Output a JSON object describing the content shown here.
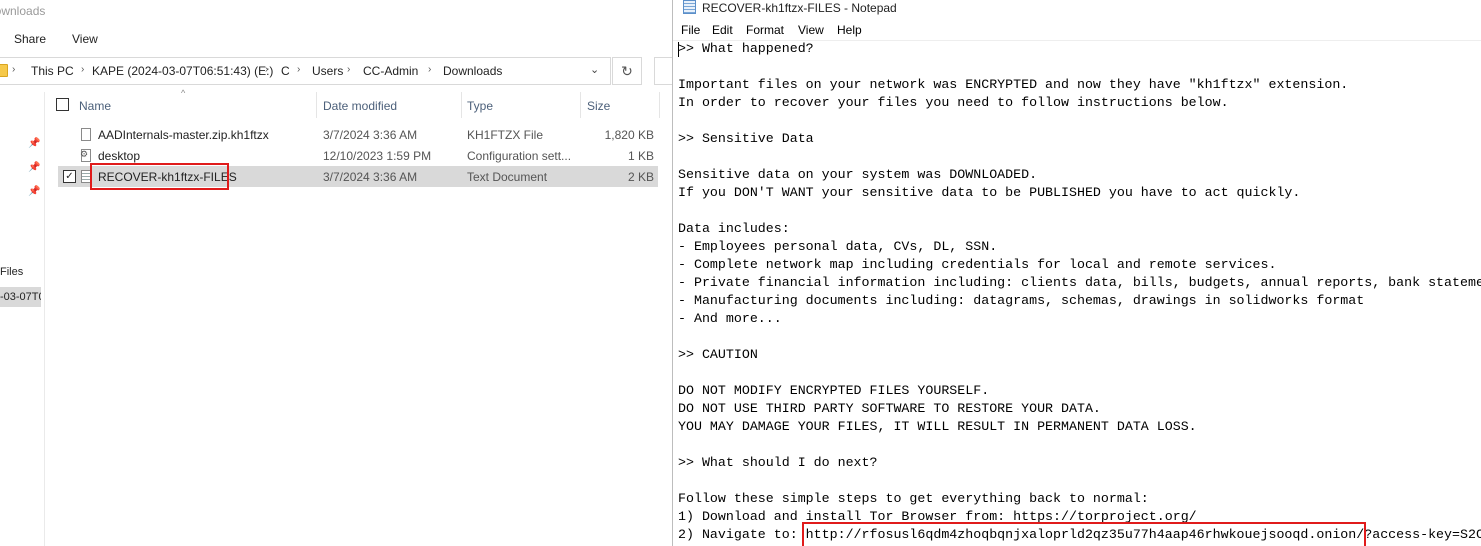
{
  "explorer": {
    "window_title": "Downloads",
    "ribbon": {
      "share": "Share",
      "view": "View"
    },
    "address_crumbs": [
      "This PC",
      "KAPE (2024-03-07T06:51:43) (E:)",
      "C",
      "Users",
      "CC-Admin",
      "Downloads"
    ],
    "refresh_icon": "refresh-icon",
    "columns": {
      "name": "Name",
      "date": "Date modified",
      "type": "Type",
      "size": "Size"
    },
    "nav": {
      "files": "Files",
      "kape": "-03-07T0"
    },
    "files": [
      {
        "name": "AADInternals-master.zip.kh1ftzx",
        "date": "3/7/2024 3:36 AM",
        "type": "KH1FTZX File",
        "size": "1,820 KB"
      },
      {
        "name": "desktop",
        "date": "12/10/2023 1:59 PM",
        "type": "Configuration sett...",
        "size": "1 KB"
      },
      {
        "name": "RECOVER-kh1ftzx-FILES",
        "date": "3/7/2024 3:36 AM",
        "type": "Text Document",
        "size": "2 KB"
      }
    ],
    "highlight_color": "#e01b1b",
    "selection_color": "#d9d9d9"
  },
  "notepad": {
    "title": "RECOVER-kh1ftzx-FILES - Notepad",
    "menu": {
      "file": "File",
      "edit": "Edit",
      "format": "Format",
      "view": "View",
      "help": "Help"
    },
    "content": [
      ">> What happened?",
      "",
      "Important files on your network was ENCRYPTED and now they have \"kh1ftzx\" extension.",
      "In order to recover your files you need to follow instructions below.",
      "",
      ">> Sensitive Data",
      "",
      "Sensitive data on your system was DOWNLOADED.",
      "If you DON'T WANT your sensitive data to be PUBLISHED you have to act quickly.",
      "",
      "Data includes:",
      "- Employees personal data, CVs, DL, SSN.",
      "- Complete network map including credentials for local and remote services.",
      "- Private financial information including: clients data, bills, budgets, annual reports, bank statements.",
      "- Manufacturing documents including: datagrams, schemas, drawings in solidworks format",
      "- And more...",
      "",
      ">> CAUTION",
      "",
      "DO NOT MODIFY ENCRYPTED FILES YOURSELF.",
      "DO NOT USE THIRD PARTY SOFTWARE TO RESTORE YOUR DATA.",
      "YOU MAY DAMAGE YOUR FILES, IT WILL RESULT IN PERMANENT DATA LOSS.",
      "",
      ">> What should I do next?",
      "",
      "Follow these simple steps to get everything back to normal:",
      "1) Download and install Tor Browser from: https://torproject.org/",
      "2) Navigate to: http://rfosusl6qdm4zhoqbqnjxaloprld2qz35u77h4aap46rhwkouejsooqd.onion/?access-key=S2C"
    ]
  }
}
